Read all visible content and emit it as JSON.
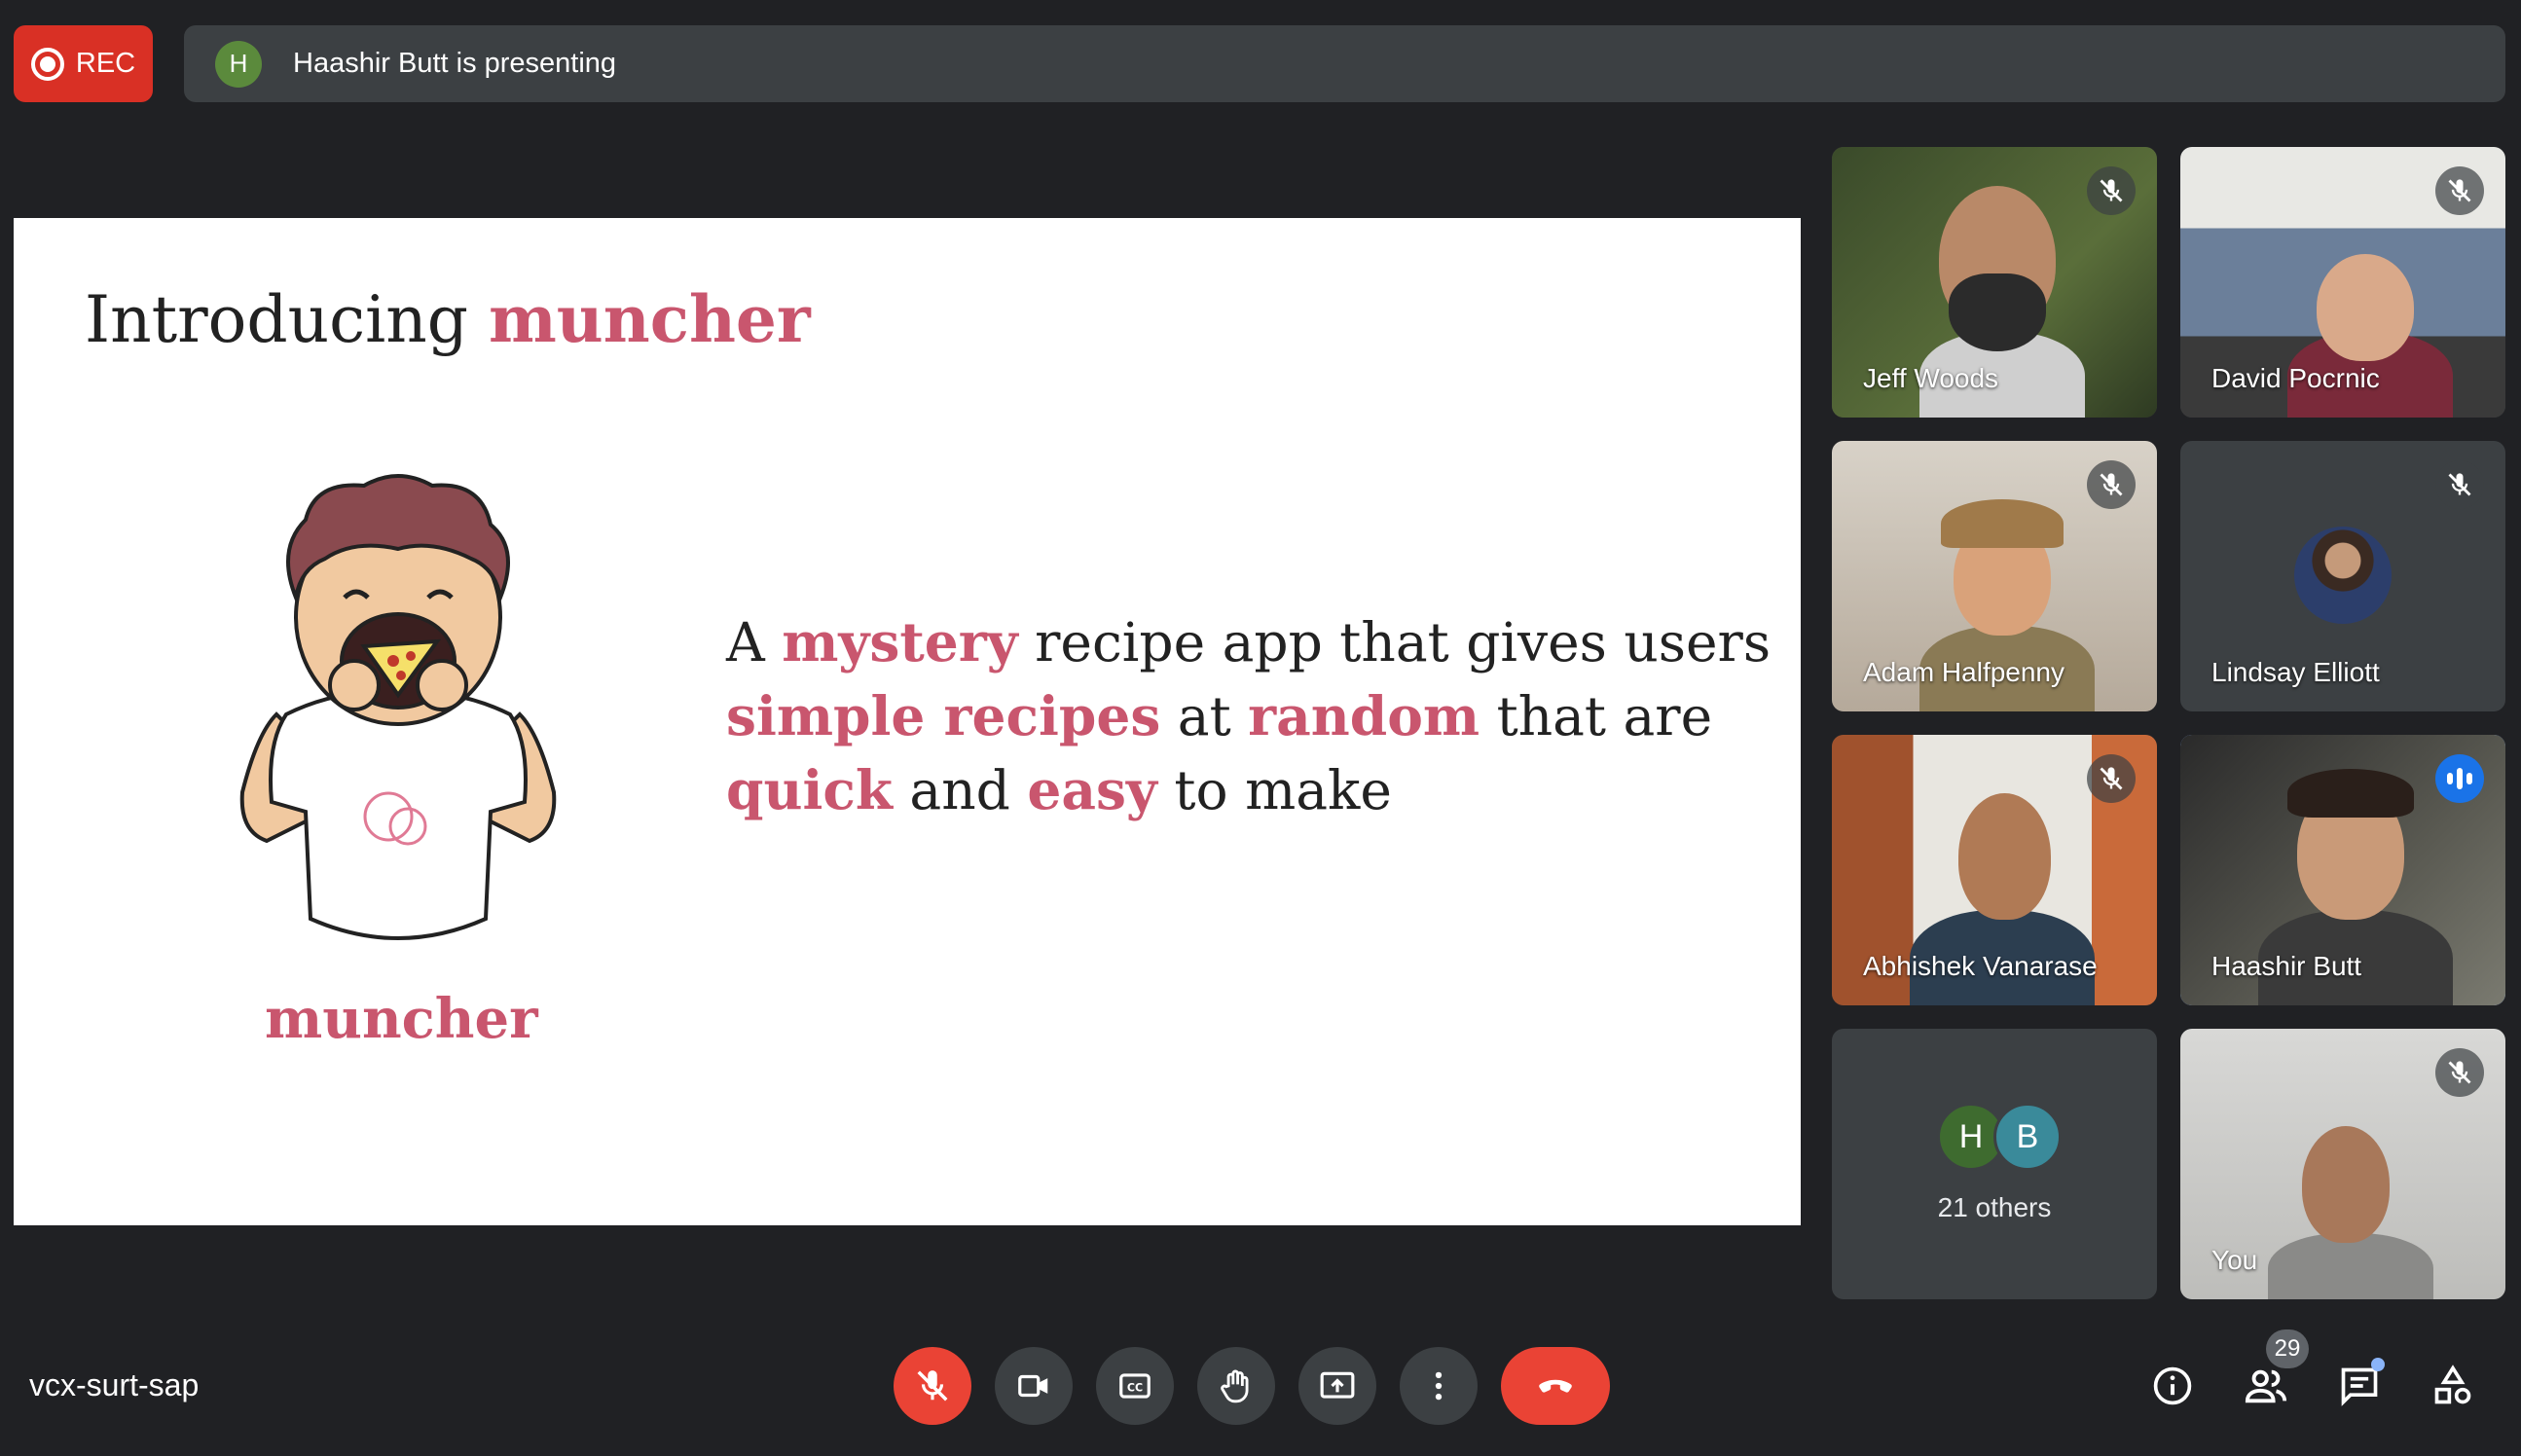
{
  "recording": {
    "label": "REC"
  },
  "presenting": {
    "avatar_initial": "H",
    "text": "Haashir Butt is presenting"
  },
  "slide": {
    "title_plain": "Introducing ",
    "title_accent": "muncher",
    "mascot_name": "muncher",
    "tagline": [
      {
        "text": "A ",
        "hl": false
      },
      {
        "text": "mystery",
        "hl": true
      },
      {
        "text": " recipe app that gives users ",
        "hl": false
      },
      {
        "text": "simple recipes",
        "hl": true
      },
      {
        "text": " at ",
        "hl": false
      },
      {
        "text": "random",
        "hl": true
      },
      {
        "text": " that are ",
        "hl": false
      },
      {
        "text": "quick",
        "hl": true
      },
      {
        "text": " and ",
        "hl": false
      },
      {
        "text": "easy",
        "hl": true
      },
      {
        "text": " to make",
        "hl": false
      }
    ],
    "accent_color": "#c9566e"
  },
  "participants": [
    {
      "name": "Jeff Woods",
      "muted": true
    },
    {
      "name": "David Pocrnic",
      "muted": true
    },
    {
      "name": "Adam Halfpenny",
      "muted": true
    },
    {
      "name": "Lindsay Elliott",
      "muted": true
    },
    {
      "name": "Abhishek Vanarase",
      "muted": true
    },
    {
      "name": "Haashir Butt",
      "muted": false,
      "speaking": true
    },
    {
      "name": "You",
      "muted": true
    }
  ],
  "others": {
    "initials": [
      "H",
      "B"
    ],
    "label": "21 others"
  },
  "meeting": {
    "code": "vcx-surt-sap",
    "participant_count": "29"
  },
  "controls": [
    "mic-off-icon",
    "camera-icon",
    "captions-icon",
    "raise-hand-icon",
    "present-icon",
    "more-icon",
    "end-call-icon"
  ],
  "colors": {
    "end_call": "#ea4335",
    "active_speaker": "#8ab4f8",
    "speaking": "#1a73e8"
  }
}
